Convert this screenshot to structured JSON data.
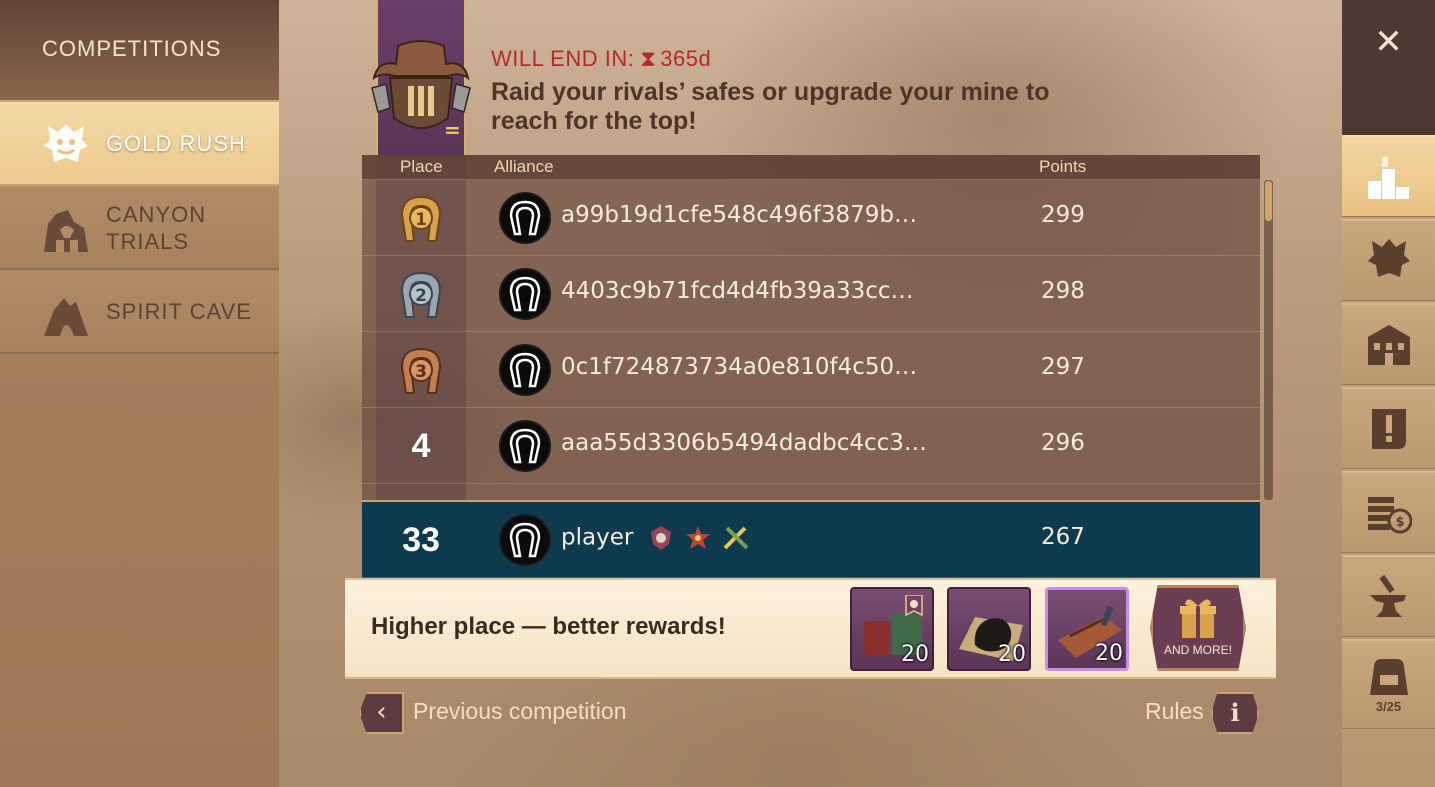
{
  "sidebar": {
    "title": "COMPETITIONS",
    "items": [
      {
        "label": "GOLD RUSH",
        "icon": "gold-rush-icon",
        "active": true
      },
      {
        "label": "CANYON\nTRIALS",
        "icon": "canyon-trials-icon",
        "active": false
      },
      {
        "label": "SPIRIT CAVE",
        "icon": "spirit-cave-icon",
        "active": false
      }
    ]
  },
  "header": {
    "ends_label": "WILL END IN:",
    "ends_value": "365d",
    "description": "Raid your rivals’ safes or upgrade your mine to reach for the top!",
    "rank_change": "="
  },
  "board": {
    "columns": {
      "place": "Place",
      "alliance": "Alliance",
      "points": "Points"
    },
    "rows": [
      {
        "place": "1",
        "alliance": "a99b19d1cfe548c496f3879b…",
        "points": "299"
      },
      {
        "place": "2",
        "alliance": "4403c9b71fcd4d4fb39a33cc…",
        "points": "298"
      },
      {
        "place": "3",
        "alliance": "0c1f724873734a0e810f4c50…",
        "points": "297"
      },
      {
        "place": "4",
        "alliance": "aaa55d3306b5494dadbc4cc3…",
        "points": "296"
      }
    ],
    "me": {
      "place": "33",
      "alliance": "player",
      "points": "267"
    }
  },
  "rewards": {
    "text": "Higher place — better rewards!",
    "items": [
      {
        "icon": "supply-chest-icon",
        "qty": "20"
      },
      {
        "icon": "coal-icon",
        "qty": "20"
      },
      {
        "icon": "toolbox-icon",
        "qty": "20"
      }
    ],
    "more_label": "AND MORE!"
  },
  "footer": {
    "prev_label": "Previous competition",
    "rules_label": "Rules"
  },
  "rightnav": {
    "close_glyph": "✕",
    "backpack_count": "3/25"
  },
  "colors": {
    "accent_purple": "#6b3f6a",
    "me_row": "#0e3a4e",
    "warning_red": "#b22c26",
    "banner": "#fdf1dd"
  }
}
